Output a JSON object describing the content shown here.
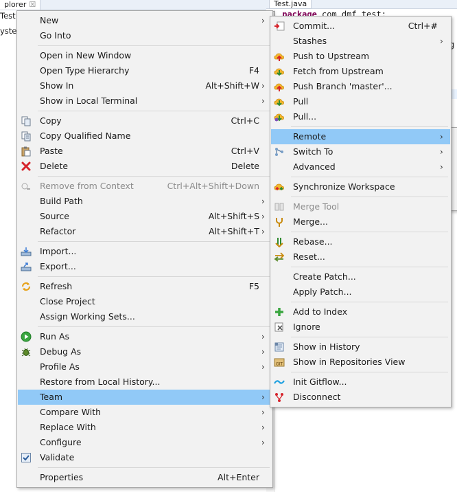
{
  "background": {
    "explorer_tab": "plorer",
    "explorer_close": "☒",
    "tree_items": [
      "Test",
      "yste"
    ],
    "editor_tab": "Test.java",
    "code_line_number": "1",
    "code_keyword": "package",
    "code_text": " com.dmf.test;",
    "code_fragment": "g"
  },
  "context_menu": {
    "items": [
      {
        "label": "New",
        "submenu": true
      },
      {
        "label": "Go Into"
      },
      {
        "label": "Open in New Window"
      },
      {
        "label": "Open Type Hierarchy",
        "shortcut": "F4"
      },
      {
        "label": "Show In",
        "shortcut": "Alt+Shift+W",
        "submenu": true
      },
      {
        "label": "Show in Local Terminal",
        "submenu": true
      },
      {
        "label": "Copy",
        "shortcut": "Ctrl+C",
        "icon": "copy-icon"
      },
      {
        "label": "Copy Qualified Name",
        "icon": "copy-qualified-icon"
      },
      {
        "label": "Paste",
        "shortcut": "Ctrl+V",
        "icon": "paste-icon"
      },
      {
        "label": "Delete",
        "shortcut": "Delete",
        "icon": "delete-icon"
      },
      {
        "label": "Remove from Context",
        "shortcut": "Ctrl+Alt+Shift+Down",
        "disabled": true,
        "icon": "remove-context-icon"
      },
      {
        "label": "Build Path",
        "submenu": true
      },
      {
        "label": "Source",
        "shortcut": "Alt+Shift+S",
        "submenu": true
      },
      {
        "label": "Refactor",
        "shortcut": "Alt+Shift+T",
        "submenu": true
      },
      {
        "label": "Import...",
        "icon": "import-icon"
      },
      {
        "label": "Export...",
        "icon": "export-icon"
      },
      {
        "label": "Refresh",
        "shortcut": "F5",
        "icon": "refresh-icon"
      },
      {
        "label": "Close Project"
      },
      {
        "label": "Assign Working Sets..."
      },
      {
        "label": "Run As",
        "submenu": true,
        "icon": "run-icon"
      },
      {
        "label": "Debug As",
        "submenu": true,
        "icon": "debug-icon"
      },
      {
        "label": "Profile As",
        "submenu": true
      },
      {
        "label": "Restore from Local History..."
      },
      {
        "label": "Team",
        "submenu": true,
        "selected": true
      },
      {
        "label": "Compare With",
        "submenu": true
      },
      {
        "label": "Replace With",
        "submenu": true
      },
      {
        "label": "Configure",
        "submenu": true
      },
      {
        "label": "Validate",
        "icon": "check-icon"
      },
      {
        "label": "Properties",
        "shortcut": "Alt+Enter"
      }
    ],
    "arrow": "›"
  },
  "team_menu": {
    "items": [
      {
        "label": "Commit...",
        "shortcut": "Ctrl+#",
        "icon": "commit-icon"
      },
      {
        "label": "Stashes",
        "submenu": true
      },
      {
        "label": "Push to Upstream",
        "icon": "push-icon"
      },
      {
        "label": "Fetch from Upstream",
        "icon": "fetch-icon"
      },
      {
        "label": "Push Branch 'master'...",
        "icon": "push-branch-icon"
      },
      {
        "label": "Pull",
        "icon": "pull-icon"
      },
      {
        "label": "Pull...",
        "icon": "pull-dialog-icon"
      },
      {
        "label": "Remote",
        "submenu": true,
        "selected": true
      },
      {
        "label": "Switch To",
        "submenu": true,
        "icon": "switch-icon"
      },
      {
        "label": "Advanced",
        "submenu": true
      },
      {
        "label": "Synchronize Workspace",
        "icon": "synchronize-icon"
      },
      {
        "label": "Merge Tool",
        "disabled": true,
        "icon": "merge-tool-icon"
      },
      {
        "label": "Merge...",
        "icon": "merge-icon"
      },
      {
        "label": "Rebase...",
        "icon": "rebase-icon"
      },
      {
        "label": "Reset...",
        "icon": "reset-icon"
      },
      {
        "label": "Create Patch..."
      },
      {
        "label": "Apply Patch..."
      },
      {
        "label": "Add to Index",
        "icon": "add-index-icon"
      },
      {
        "label": "Ignore",
        "icon": "ignore-icon"
      },
      {
        "label": "Show in History",
        "icon": "history-icon"
      },
      {
        "label": "Show in Repositories View",
        "icon": "repositories-icon"
      },
      {
        "label": "Init Gitflow...",
        "icon": "gitflow-icon"
      },
      {
        "label": "Disconnect",
        "icon": "disconnect-icon"
      }
    ]
  }
}
